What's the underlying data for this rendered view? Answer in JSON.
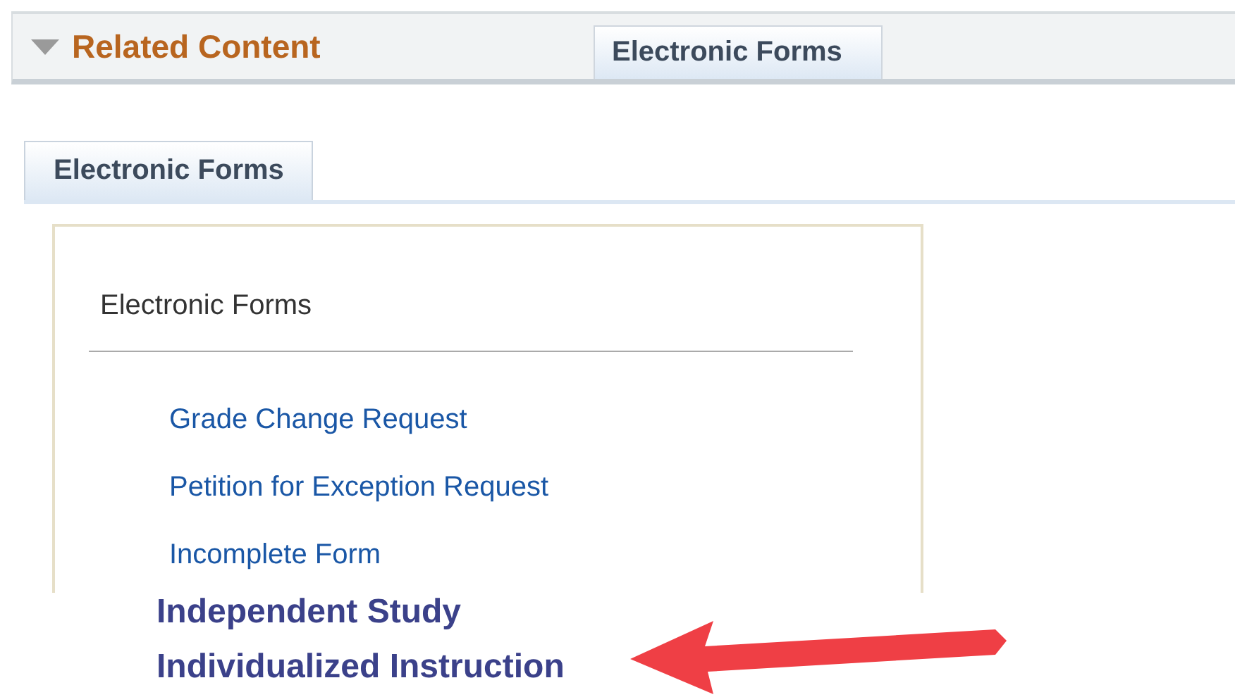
{
  "header": {
    "title": "Related Content",
    "expanded": true,
    "tabs": [
      {
        "label": "Electronic Forms",
        "selected": true
      }
    ]
  },
  "tabs": [
    {
      "label": "Electronic Forms",
      "selected": true
    }
  ],
  "panel": {
    "title": "Electronic Forms",
    "links": [
      "Grade Change Request",
      "Petition for Exception Request",
      "Incomplete Form"
    ]
  },
  "annotation": {
    "lines": [
      "Independent Study",
      "Individualized Instruction"
    ]
  }
}
